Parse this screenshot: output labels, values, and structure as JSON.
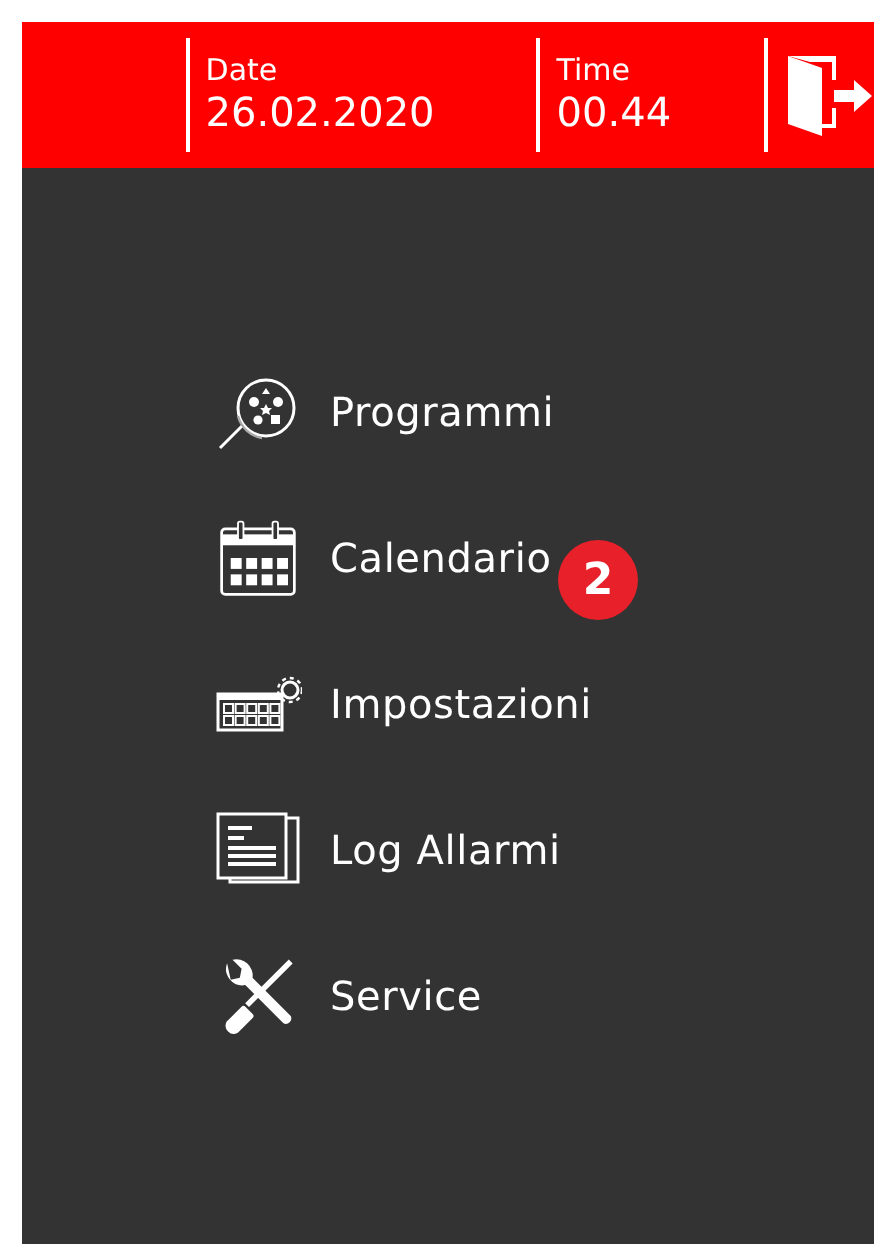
{
  "header": {
    "date_label": "Date",
    "date": "26.02.2020",
    "time_label": "Time",
    "time": "00.44"
  },
  "menu": [
    {
      "kind": "programs",
      "label": "Programmi"
    },
    {
      "kind": "calendar",
      "label": "Calendario",
      "badge": "2"
    },
    {
      "kind": "settings",
      "label": "Impostazioni"
    },
    {
      "kind": "log",
      "label": "Log Allarmi"
    },
    {
      "kind": "service",
      "label": "Service"
    }
  ]
}
